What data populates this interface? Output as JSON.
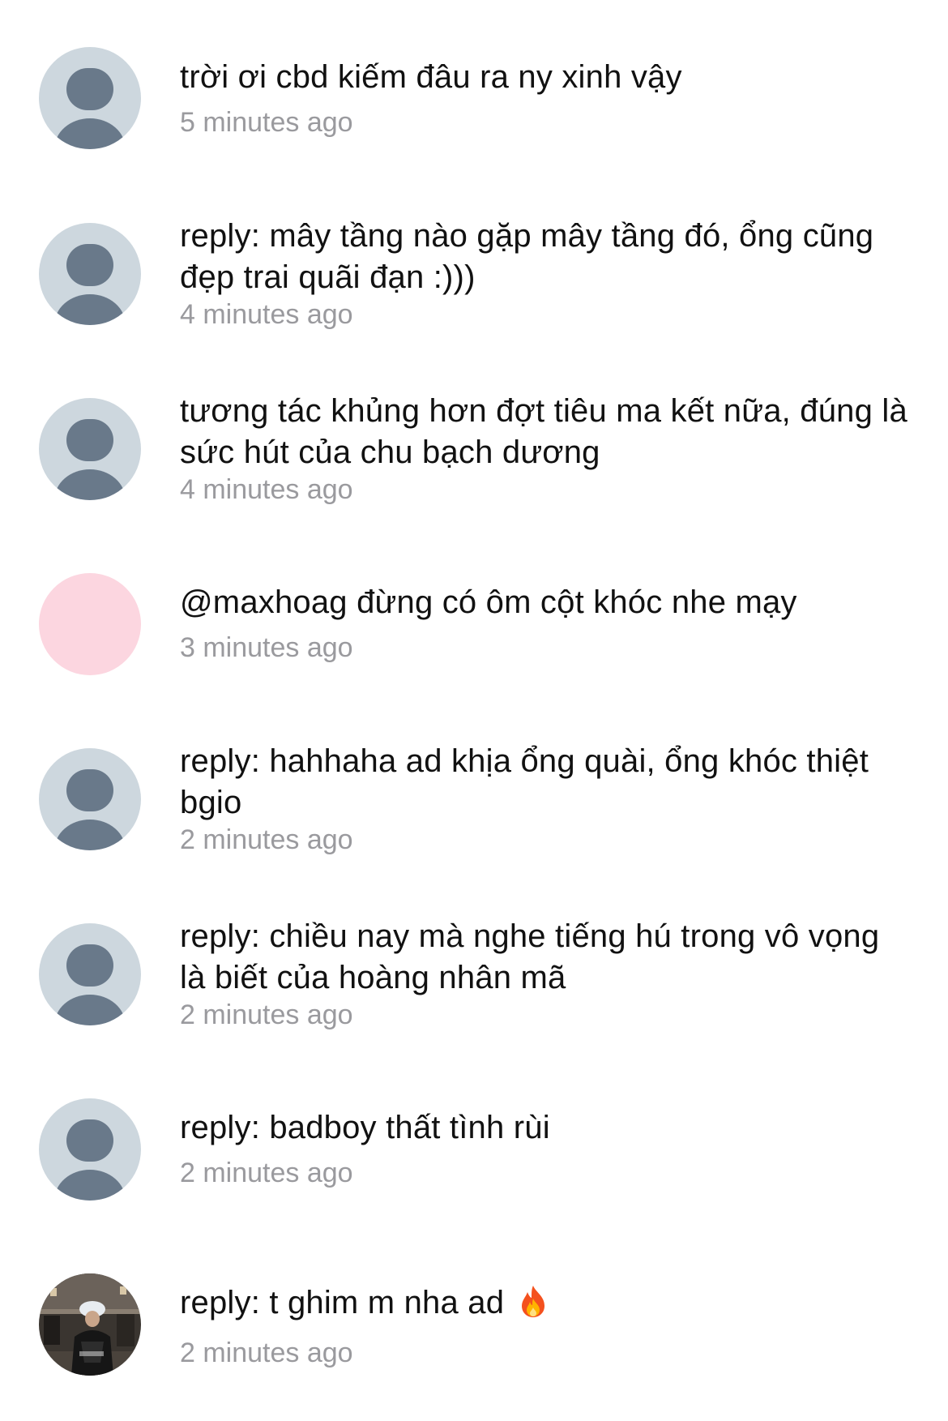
{
  "comments": [
    {
      "text": "trời ơi cbd kiếm đâu ra ny xinh vậy",
      "time": "5 minutes ago",
      "avatar": "default-person-icon"
    },
    {
      "text": "reply: mây tầng nào gặp mây tầng đó, ổng cũng đẹp trai quãi đạn :)))",
      "time": "4 minutes ago",
      "avatar": "default-person-icon"
    },
    {
      "text": "tương tác khủng hơn đợt tiêu ma kết nữa, đúng là sức hút của chu bạch dương",
      "time": "4 minutes ago",
      "avatar": "default-person-icon"
    },
    {
      "text": "@maxhoag đừng có ôm cột khóc nhe mạy",
      "time": "3 minutes ago",
      "avatar": "pink-avatar"
    },
    {
      "text": "reply: hahhaha ad khịa ổng quài, ổng khóc thiệt bgio",
      "time": "2 minutes ago",
      "avatar": "default-person-icon"
    },
    {
      "text": "reply: chiều nay mà nghe tiếng hú trong vô vọng là biết của hoàng nhân mã",
      "time": "2 minutes ago",
      "avatar": "default-person-icon"
    },
    {
      "text": "reply: badboy thất tình rùi",
      "time": "2 minutes ago",
      "avatar": "default-person-icon"
    },
    {
      "text": "reply: t ghim m nha ad ",
      "time": "2 minutes ago",
      "avatar": "user-photo",
      "emoji": "fire-emoji-icon"
    }
  ],
  "colors": {
    "avatar_bg": "#cdd7de",
    "avatar_figure": "#69798a",
    "pink_avatar": "#fcd6e0",
    "time_text": "#9a9a9e",
    "body_text": "#111111"
  }
}
